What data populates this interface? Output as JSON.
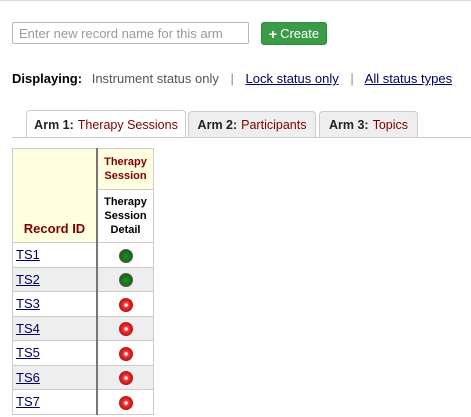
{
  "create": {
    "placeholder": "Enter new record name for this arm",
    "button_label": "Create",
    "button_icon": "plus-icon",
    "button_color": "#3a9b48"
  },
  "displaying": {
    "label": "Displaying:",
    "current": "Instrument status only",
    "separator": "|",
    "options": [
      "Lock status only",
      "All status types"
    ]
  },
  "tabs": [
    {
      "number": "Arm 1:",
      "label": "Therapy Sessions",
      "active": true
    },
    {
      "number": "Arm 2:",
      "label": "Participants",
      "active": false
    },
    {
      "number": "Arm 3:",
      "label": "Topics",
      "active": false
    }
  ],
  "grid": {
    "record_id_header": "Record ID",
    "event_header": "Therapy Session",
    "form_header": "Therapy Session Detail",
    "rows": [
      {
        "id": "TS1",
        "status": "green"
      },
      {
        "id": "TS2",
        "status": "green"
      },
      {
        "id": "TS3",
        "status": "red"
      },
      {
        "id": "TS4",
        "status": "red"
      },
      {
        "id": "TS5",
        "status": "red"
      },
      {
        "id": "TS6",
        "status": "red"
      },
      {
        "id": "TS7",
        "status": "red"
      }
    ]
  },
  "colors": {
    "header_bg": "#ffffe0",
    "header_text": "#800000",
    "link": "#000066",
    "status_complete": "#17751a",
    "status_incomplete": "#e21b1b"
  }
}
